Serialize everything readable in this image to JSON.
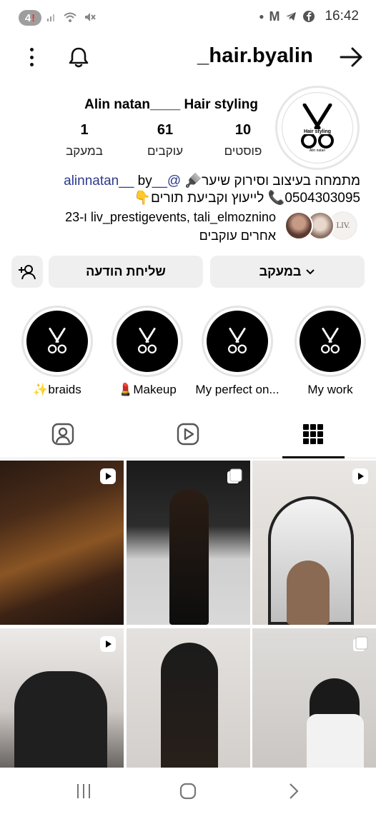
{
  "status_bar": {
    "notification_count": "4",
    "time": "16:42",
    "icons": [
      "notification-count-icon",
      "signal-icon",
      "wifi-icon",
      "mute-icon",
      "dot-icon",
      "gmail-icon",
      "telegram-icon",
      "facebook-icon"
    ]
  },
  "header": {
    "username": "_hair.byalin",
    "icons": [
      "kebab-menu-icon",
      "bell-icon",
      "back-arrow-icon"
    ]
  },
  "profile": {
    "full_name": "Alin natan____ Hair styling",
    "avatar_text": "Hair styling",
    "avatar_subtext": "Alin natan",
    "stats": [
      {
        "value": "10",
        "label": "פוסטים"
      },
      {
        "value": "61",
        "label": "עוקבים"
      },
      {
        "value": "1",
        "label": "במעקב"
      }
    ],
    "bio_line1_text": "מתמחה בעיצוב וסירוק שיער🪮",
    "bio_line1_handle": "@__alinnatan__",
    "bio_line1_suffix": "by",
    "bio_line2": "0504303095📞 לייעוץ וקביעת תורים👇",
    "followed_by_line1": "liv_prestigevents, tali_elmoznino ו-23",
    "followed_by_line2": "אחרים עוקבים",
    "followed_by_avatar3_text": "LIV."
  },
  "actions": {
    "follow_label": "במעקב",
    "message_label": "שליחת הודעה",
    "add_user_icon": "add-user-icon"
  },
  "highlights": [
    {
      "label": "My work"
    },
    {
      "label": "My perfect on..."
    },
    {
      "label": "💄Makeup"
    },
    {
      "label": "✨braids"
    }
  ],
  "tabs": {
    "active": "grid",
    "items": [
      "grid-icon",
      "reels-icon",
      "tagged-icon"
    ]
  },
  "colors": {
    "accent_link": "#2d3a8c",
    "button_bg": "#efefef",
    "highlight_bg": "#000000"
  }
}
